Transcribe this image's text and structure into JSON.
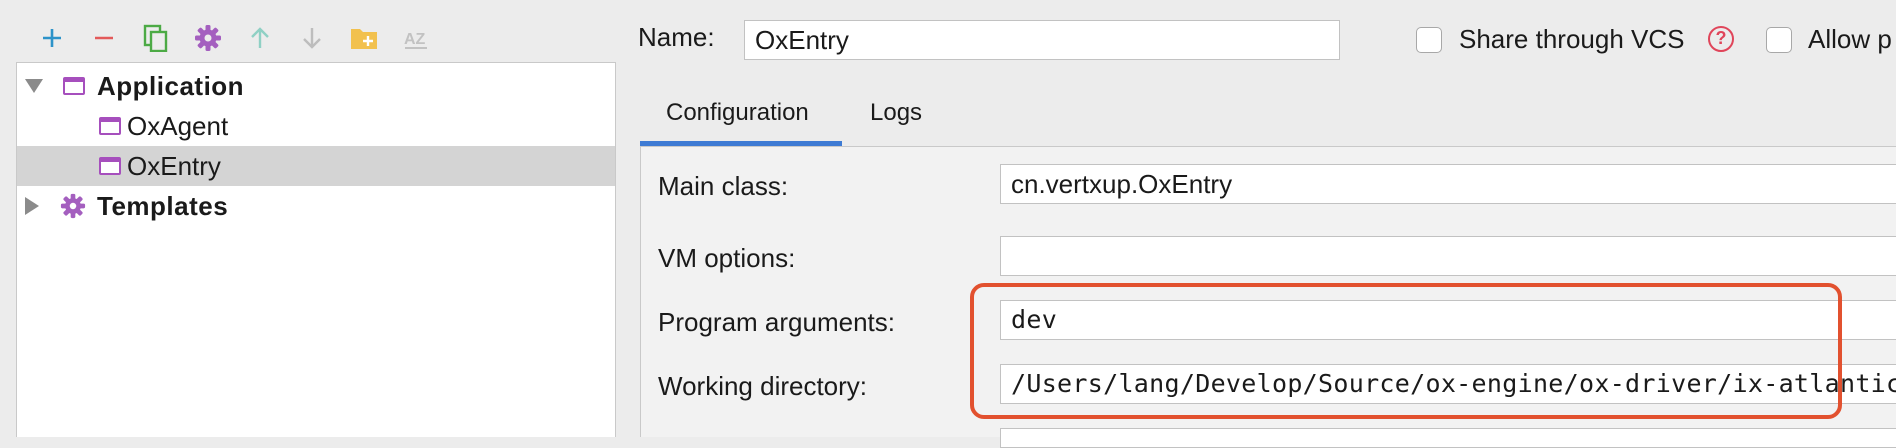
{
  "toolbar": {
    "buttons": [
      {
        "name": "add-icon",
        "color": "#2d93c9"
      },
      {
        "name": "remove-icon",
        "color": "#e35a5a"
      },
      {
        "name": "copy-icon",
        "color": "#4caa45"
      },
      {
        "name": "gear-icon",
        "color": "#a45fbf"
      },
      {
        "name": "move-up-icon",
        "color": "#8fd0c4"
      },
      {
        "name": "move-down-icon",
        "color": "#bdbdbd"
      },
      {
        "name": "folder-add-icon",
        "color": "#f2c14e"
      },
      {
        "name": "sort-az-icon",
        "color": "#c2c2c2"
      }
    ],
    "sort_label": "AZ"
  },
  "tree": {
    "application_label": "Application",
    "items": [
      "OxAgent",
      "OxEntry"
    ],
    "selected": "OxEntry",
    "templates_label": "Templates"
  },
  "header": {
    "name_label": "Name:",
    "name_value": "OxEntry",
    "share_label": "Share through VCS",
    "allow_label": "Allow p"
  },
  "tabs": {
    "configuration": "Configuration",
    "logs": "Logs",
    "active": "Configuration"
  },
  "form": {
    "main_class_label": "Main class:",
    "main_class_value": "cn.vertxup.OxEntry",
    "vm_options_label": "VM options:",
    "vm_options_value": "",
    "program_args_label": "Program arguments:",
    "program_args_value": "dev",
    "working_dir_label": "Working directory:",
    "working_dir_value": "/Users/lang/Develop/Source/ox-engine/ox-driver/ix-atlantic"
  },
  "colors": {
    "accent": "#3e7bd4",
    "highlight": "#e2512f",
    "run_config_icon": "#a64fbd"
  }
}
